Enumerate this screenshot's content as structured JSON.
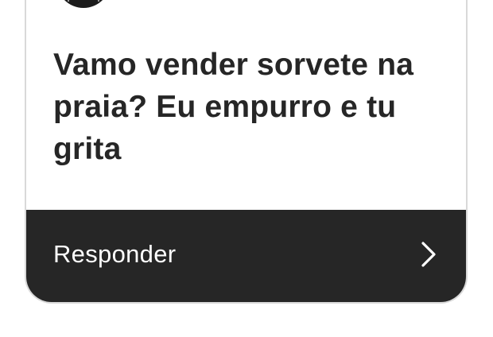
{
  "question_card": {
    "avatar_icon": "profile-avatar-icon",
    "question_text": "Vamo vender sorvete na praia? Eu empurro e tu grita",
    "reply_label": "Responder",
    "reply_icon": "chevron-right-icon"
  },
  "colors": {
    "text_dark": "#262626",
    "reply_bar_bg": "#262626",
    "reply_text": "#ffffff",
    "card_border": "#d9d9d9"
  }
}
